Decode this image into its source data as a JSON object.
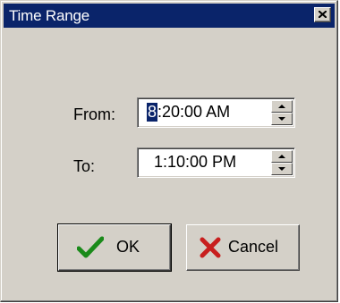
{
  "window": {
    "title": "Time Range",
    "close_icon": "close-icon"
  },
  "range": {
    "from_label": "From:",
    "from_value_selected": "8",
    "from_value_rest": ":20:00 AM",
    "to_label": "To:",
    "to_value": "1:10:00 PM"
  },
  "buttons": {
    "ok_label": "OK",
    "ok_icon": "checkmark-icon",
    "cancel_label": "Cancel",
    "cancel_icon": "x-icon"
  }
}
